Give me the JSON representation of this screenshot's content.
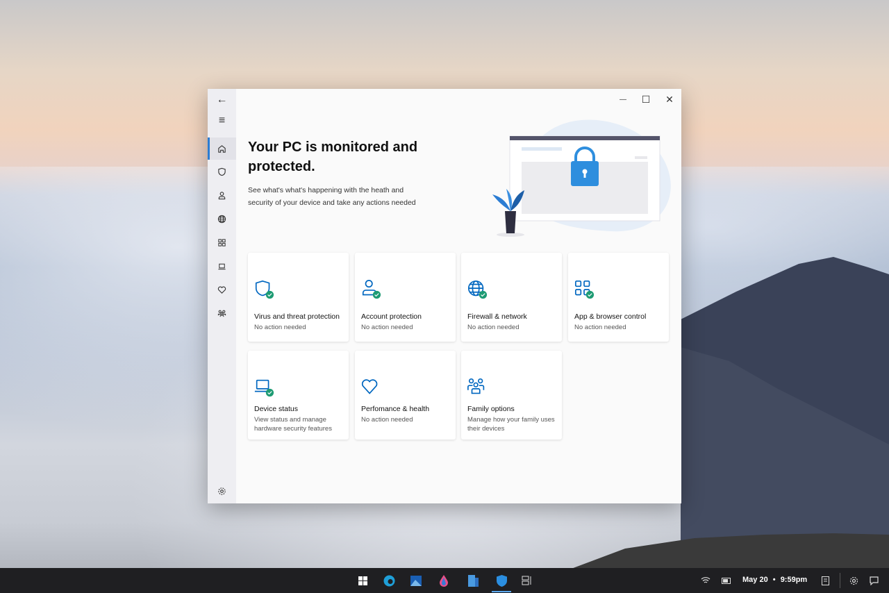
{
  "window": {
    "controls": {
      "minimize": "—",
      "maximize": "☐",
      "close": "✕"
    }
  },
  "sidebar": {
    "back": "←",
    "menu": "≡",
    "items": [
      "home",
      "virus",
      "account",
      "firewall",
      "app-browser",
      "device",
      "performance",
      "family"
    ],
    "settings": "settings"
  },
  "hero": {
    "title": "Your PC is monitored and protected.",
    "description": "See what's what's happening with the heath and security of your device and take any actions needed"
  },
  "cards": [
    {
      "title": "Virus and threat protection",
      "status": "No action needed",
      "icon": "shield-icon",
      "ok": true
    },
    {
      "title": "Account protection",
      "status": "No action needed",
      "icon": "person-icon",
      "ok": true
    },
    {
      "title": "Firewall & network",
      "status": "No action needed",
      "icon": "globe-icon",
      "ok": true
    },
    {
      "title": "App & browser control",
      "status": "No action needed",
      "icon": "apps-icon",
      "ok": true
    },
    {
      "title": "Device status",
      "status": "View status and manage hardware security features",
      "icon": "laptop-icon",
      "ok": true
    },
    {
      "title": "Perfomance & health",
      "status": "No action needed",
      "icon": "heart-icon",
      "ok": false
    },
    {
      "title": "Family options",
      "status": "Manage how your family uses their devices",
      "icon": "family-icon",
      "ok": false
    }
  ],
  "taskbar": {
    "date": "May 20",
    "time": "9:59pm",
    "separator": "•"
  },
  "colors": {
    "accent": "#0067c0",
    "check": "#1e9b73"
  }
}
